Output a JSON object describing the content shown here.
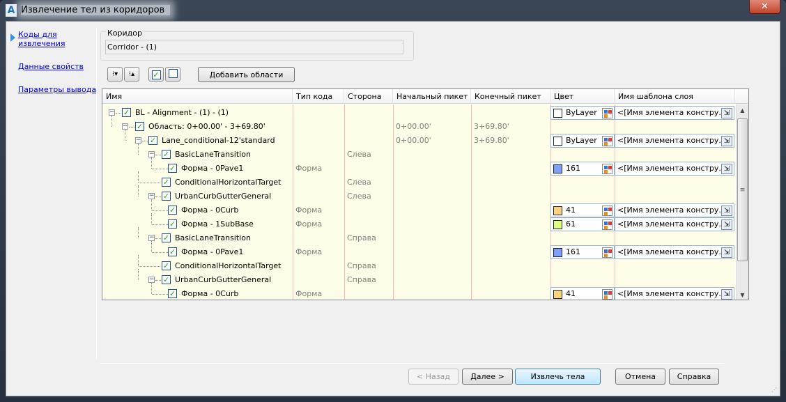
{
  "window": {
    "title": "Извлечение тел из коридоров",
    "close_label": "✕"
  },
  "nav": {
    "items": [
      {
        "label": "Коды для извлечения",
        "active": true
      },
      {
        "label": "Данные свойств"
      },
      {
        "label": "Параметры вывода"
      }
    ]
  },
  "corridor": {
    "group_label": "Коридор",
    "value": "Corridor - (1)"
  },
  "toolbar": {
    "add_regions_label": "Добавить области"
  },
  "grid": {
    "columns": [
      "Имя",
      "Тип кода",
      "Сторона",
      "Начальный пикет",
      "Конечный пикет",
      "Цвет",
      "Имя шаблона слоя"
    ],
    "rows": [
      {
        "level": 0,
        "name": "BL - Alignment - (1) - (1)",
        "type": "",
        "side": "",
        "start": "",
        "end": "",
        "color": "ByLayer",
        "swatch": "#ffffff",
        "template": "<[Имя элемента констру..."
      },
      {
        "level": 1,
        "name": "Область: 0+00.00' - 3+69.80'",
        "type": "",
        "side": "",
        "start": "0+00.00'",
        "end": "3+69.80'",
        "color": "",
        "swatch": "",
        "template": ""
      },
      {
        "level": 2,
        "name": "Lane_conditional-12'standard",
        "type": "",
        "side": "",
        "start": "0+00.00'",
        "end": "3+69.80'",
        "color": "ByLayer",
        "swatch": "#ffffff",
        "template": "<[Имя элемента констру..."
      },
      {
        "level": 3,
        "name": "BasicLaneTransition",
        "type": "",
        "side": "Слева",
        "start": "",
        "end": "",
        "color": "",
        "swatch": "",
        "template": ""
      },
      {
        "level": 4,
        "name": "Форма - 0Pave1",
        "type": "Форма",
        "side": "",
        "start": "",
        "end": "",
        "color": "161",
        "swatch": "#7f9fff",
        "template": "<[Имя элемента констру..."
      },
      {
        "level": 3,
        "leaf": true,
        "name": "ConditionalHorizontalTarget",
        "type": "",
        "side": "Слева",
        "start": "",
        "end": "",
        "color": "",
        "swatch": "",
        "template": ""
      },
      {
        "level": 3,
        "name": "UrbanCurbGutterGeneral",
        "type": "",
        "side": "Слева",
        "start": "",
        "end": "",
        "color": "",
        "swatch": "",
        "template": ""
      },
      {
        "level": 4,
        "name": "Форма - 0Curb",
        "type": "Форма",
        "side": "",
        "start": "",
        "end": "",
        "color": "41",
        "swatch": "#ffd27f",
        "template": "<[Имя элемента констру..."
      },
      {
        "level": 4,
        "name": "Форма - 1SubBase",
        "type": "Форма",
        "side": "",
        "start": "",
        "end": "",
        "color": "61",
        "swatch": "#dfff7f",
        "template": "<[Имя элемента констру..."
      },
      {
        "level": 3,
        "name": "BasicLaneTransition",
        "type": "",
        "side": "Справа",
        "start": "",
        "end": "",
        "color": "",
        "swatch": "",
        "template": ""
      },
      {
        "level": 4,
        "name": "Форма - 0Pave1",
        "type": "Форма",
        "side": "",
        "start": "",
        "end": "",
        "color": "161",
        "swatch": "#7f9fff",
        "template": "<[Имя элемента констру..."
      },
      {
        "level": 3,
        "leaf": true,
        "name": "ConditionalHorizontalTarget",
        "type": "",
        "side": "Справа",
        "start": "",
        "end": "",
        "color": "",
        "swatch": "",
        "template": ""
      },
      {
        "level": 3,
        "name": "UrbanCurbGutterGeneral",
        "type": "",
        "side": "Справа",
        "start": "",
        "end": "",
        "color": "",
        "swatch": "",
        "template": ""
      },
      {
        "level": 4,
        "name": "Форма - 0Curb",
        "type": "Форма",
        "side": "",
        "start": "",
        "end": "",
        "color": "41",
        "swatch": "#ffd27f",
        "template": "<[Имя элемента констру..."
      }
    ]
  },
  "buttons": {
    "back": "< Назад",
    "next": "Далее >",
    "extract": "Извлечь тела",
    "cancel": "Отмена",
    "help": "Справка"
  }
}
